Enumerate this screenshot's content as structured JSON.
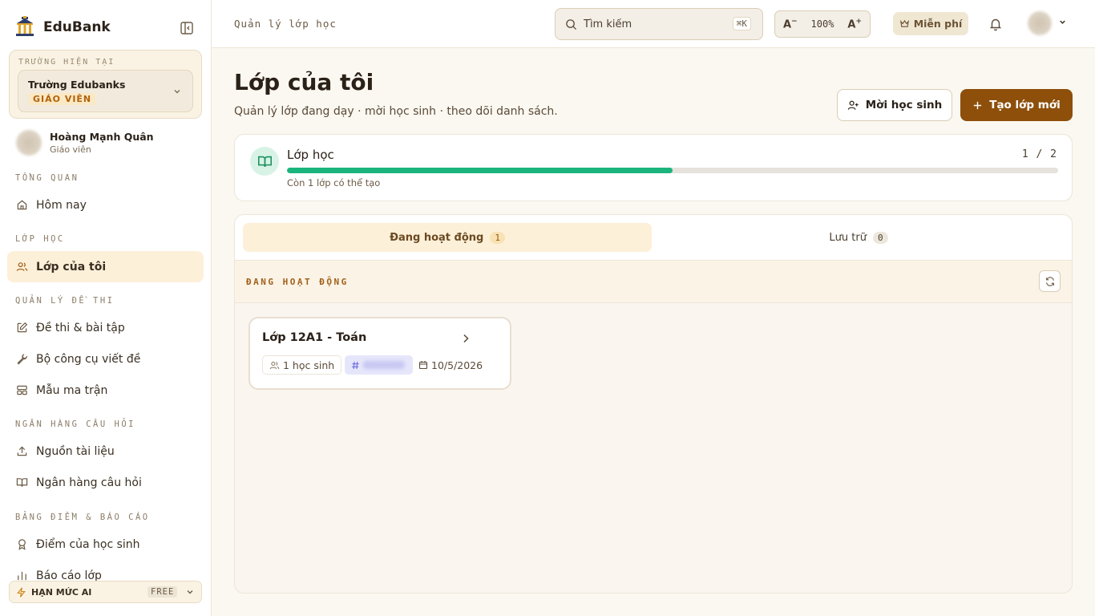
{
  "brand": {
    "name": "EduBank"
  },
  "school": {
    "label": "TRƯỜNG HIỆN TẠI",
    "name": "Trường Edubanks",
    "role": "GIÁO VIÊN"
  },
  "user": {
    "name": "Hoàng Mạnh Quân",
    "role": "Giáo viên"
  },
  "sidebar": {
    "sections": [
      "TỔNG QUAN",
      "LỚP HỌC",
      "QUẢN LÝ ĐỀ THI",
      "NGÂN HÀNG CÂU HỎI",
      "BẢNG ĐIỂM & BÁO CÁO"
    ],
    "items": [
      "Hôm nay",
      "Lớp của tôi",
      "Đề thi & bài tập",
      "Bộ công cụ viết đề",
      "Mẫu ma trận",
      "Nguồn tài liệu",
      "Ngân hàng câu hỏi",
      "Điểm của học sinh",
      "Báo cáo lớp"
    ],
    "active_item": "Lớp của tôi",
    "ai_quota": {
      "label": "HẠN MỨC AI",
      "plan": "FREE"
    }
  },
  "topbar": {
    "breadcrumb": "Quản lý lớp học",
    "search": {
      "placeholder": "Tìm kiếm",
      "shortcut": "⌘K"
    },
    "zoom": {
      "decrease": "A",
      "increase": "A",
      "value": "100%"
    },
    "plan_label": "Miễn phí"
  },
  "page": {
    "title": "Lớp của tôi",
    "subtitle": "Quản lý lớp đang dạy · mời học sinh · theo dõi danh sách.",
    "invite_button": "Mời học sinh",
    "create_button": "Tạo lớp mới"
  },
  "quota": {
    "title": "Lớp học",
    "count": "1 / 2",
    "used": 1,
    "limit": 2,
    "note": "Còn 1 lớp có thể tạo"
  },
  "tabs": [
    {
      "label": "Đang hoạt động",
      "count": "1"
    },
    {
      "label": "Lưu trữ",
      "count": "0"
    }
  ],
  "list": {
    "header": "ĐANG HOẠT ĐỘNG"
  },
  "classes": [
    {
      "name": "Lớp 12A1 - Toán",
      "students": "1 học sinh",
      "date": "10/5/2026"
    }
  ],
  "colors": {
    "accent": "#8e4f0b",
    "progress": "#1ab47c",
    "active_bg": "#fdf0d9"
  }
}
